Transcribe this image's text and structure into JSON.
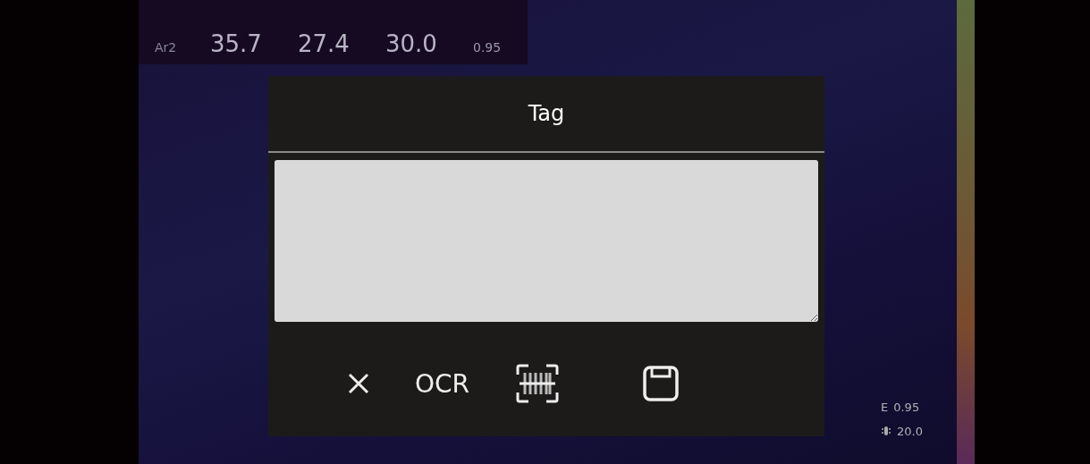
{
  "measurements": [
    {
      "label": "Ar2",
      "values": [
        "35.7",
        "27.4",
        "30.0"
      ],
      "emissivity": "0.95"
    }
  ],
  "dialog": {
    "title": "Tag",
    "toolbar": [
      {
        "kind": "close"
      },
      {
        "kind": "text",
        "label": "OCR"
      },
      {
        "kind": "scan"
      },
      {
        "kind": "save"
      }
    ]
  },
  "readings": [
    {
      "kind": "emissivity",
      "symbol": "E",
      "value": "0.95"
    },
    {
      "kind": "reflected",
      "value": "20.0"
    }
  ]
}
